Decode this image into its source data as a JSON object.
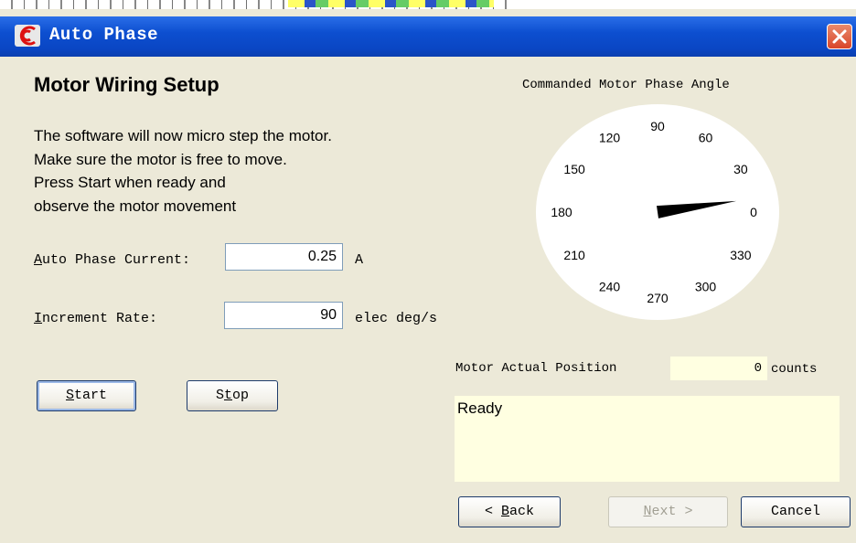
{
  "window": {
    "title": "Auto Phase"
  },
  "heading": "Motor Wiring Setup",
  "instructions": [
    "The software will now micro step the motor.",
    "Make sure the motor is free to move.",
    "Press Start when ready and",
    "observe the motor movement"
  ],
  "fields": {
    "current": {
      "label_prefix": "A",
      "label_rest": "uto Phase Current:",
      "value": "0.25",
      "unit": "A"
    },
    "rate": {
      "label_prefix": "I",
      "label_rest": "ncrement Rate:",
      "value": "90",
      "unit": "elec deg/s"
    }
  },
  "buttons": {
    "start": {
      "prefix": "S",
      "rest": "tart"
    },
    "stop": {
      "prefix": "S",
      "mnemonic": "t",
      "rest": "op"
    },
    "back": {
      "pre": "< ",
      "mnemonic": "B",
      "rest": "ack"
    },
    "next": {
      "mnemonic": "N",
      "rest": "ext >"
    },
    "cancel": {
      "label": "Cancel"
    }
  },
  "gauge": {
    "title": "Commanded Motor Phase Angle",
    "tick_labels": [
      "0",
      "30",
      "60",
      "90",
      "120",
      "150",
      "180",
      "210",
      "240",
      "270",
      "300",
      "330"
    ],
    "needle_angle_deg": 8
  },
  "position": {
    "label": "Motor Actual Position",
    "value": "0",
    "units": "counts"
  },
  "status": {
    "text": "Ready"
  },
  "colors": {
    "titlebar": "#0a46c4",
    "window_bg": "#ece9d8",
    "info_bg": "#ffffe1",
    "close": "#d9462a"
  }
}
